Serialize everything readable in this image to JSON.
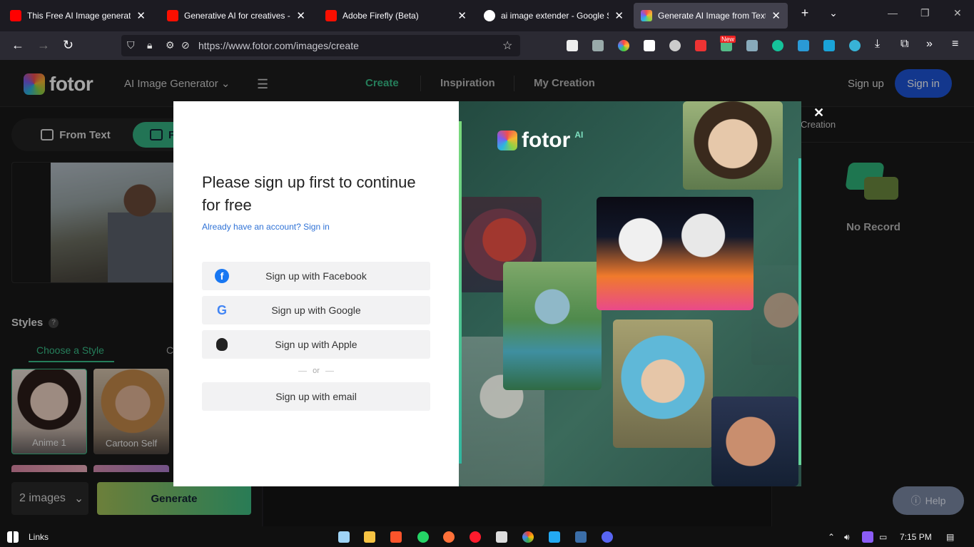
{
  "browser": {
    "tabs": [
      {
        "title": "This Free AI Image generator w",
        "favicon_color": "#ff0000",
        "active": false
      },
      {
        "title": "Generative AI for creatives - Ad",
        "favicon_color": "#fa0f00",
        "active": false
      },
      {
        "title": "Adobe Firefly (Beta)",
        "favicon_color": "#fa0f00",
        "active": false
      },
      {
        "title": "ai image extender - Google Se",
        "favicon_color": "#4285f4",
        "active": false
      },
      {
        "title": "Generate AI Image from Text O",
        "favicon_color": "#f7b731",
        "active": true
      }
    ],
    "url": "https://www.fotor.com/images/create",
    "new_badge": "New"
  },
  "header": {
    "logo_text": "fotor",
    "product_menu": "AI Image Generator",
    "tabs": [
      {
        "label": "Create",
        "active": true
      },
      {
        "label": "Inspiration",
        "active": false
      },
      {
        "label": "My Creation",
        "active": false
      }
    ],
    "sign_up": "Sign up",
    "sign_in": "Sign in"
  },
  "left_panel": {
    "mode_text": "From Text",
    "mode_photo": "F",
    "styles_title": "Styles",
    "style_tabs": [
      "Choose a Style",
      "C"
    ],
    "styles": [
      {
        "label": "Anime 1",
        "selected": true
      },
      {
        "label": "Cartoon Self",
        "selected": false
      }
    ],
    "image_count": "2 images",
    "generate_label": "Generate"
  },
  "right_panel": {
    "tab_label": "Creation",
    "empty_text": "No Record",
    "help_label": "Help"
  },
  "modal": {
    "heading": "Please sign up first to continue for free",
    "signin_prompt": "Already have an account? Sign in",
    "buttons": [
      {
        "label": "Sign up with Facebook",
        "icon": "facebook-icon"
      },
      {
        "label": "Sign up with Google",
        "icon": "google-icon"
      },
      {
        "label": "Sign up with Apple",
        "icon": "apple-icon"
      }
    ],
    "or_text": "or",
    "email_button": "Sign up with email",
    "promo_logo": "fotor",
    "promo_badge": "AI"
  },
  "taskbar": {
    "links_label": "Links",
    "time": "7:15 PM"
  },
  "colors": {
    "accent_green": "#39c18b",
    "sign_in_blue": "#1e55d9",
    "link_blue": "#2f72d6"
  }
}
